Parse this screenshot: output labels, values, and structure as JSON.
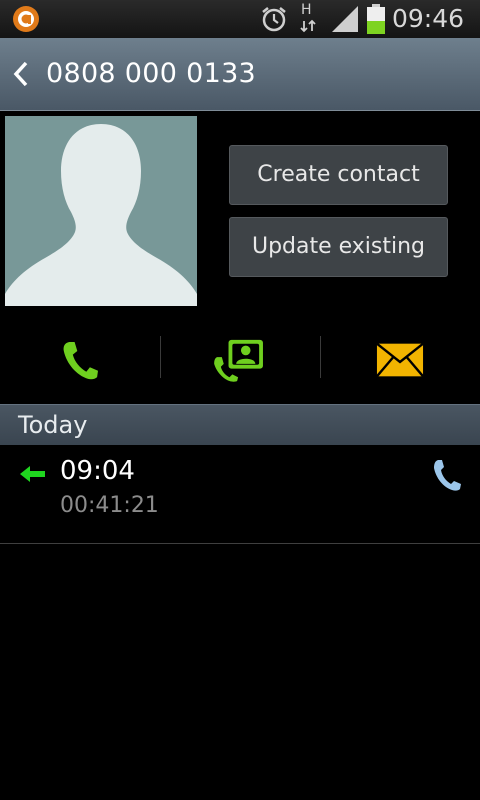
{
  "status_bar": {
    "time": "09:46",
    "network_label": "H",
    "icons": [
      "app-notification-icon",
      "alarm-icon",
      "network-h-icon",
      "signal-icon",
      "battery-icon"
    ]
  },
  "header": {
    "title": "0808 000 0133",
    "back_icon": "chevron-left-icon"
  },
  "contact": {
    "avatar_icon": "person-silhouette-icon",
    "create_contact_label": "Create contact",
    "update_existing_label": "Update existing"
  },
  "actions": [
    {
      "icon": "phone-icon",
      "color": "#6fcf1f"
    },
    {
      "icon": "video-call-icon",
      "color": "#6fcf1f"
    },
    {
      "icon": "message-icon",
      "color": "#f2b400"
    }
  ],
  "call_log": {
    "section_title": "Today",
    "entries": [
      {
        "type_icon": "incoming-arrow-icon",
        "time": "09:04",
        "duration": "00:41:21",
        "call_icon": "phone-icon"
      }
    ]
  },
  "colors": {
    "accent_green": "#6fcf1f",
    "incoming_green": "#1fd61f",
    "message_yellow": "#f2b400",
    "header_blue_gray": "#5a6876",
    "call_icon_blue": "#9cc6ea"
  }
}
